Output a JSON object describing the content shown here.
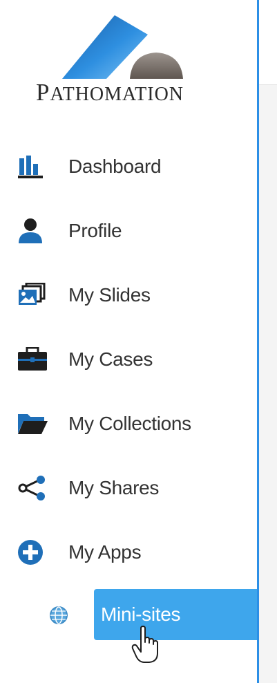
{
  "brand": {
    "logo_text_initial": "P",
    "logo_text_rest": "ATHOMATION"
  },
  "nav": {
    "items": [
      {
        "id": "dashboard",
        "label": "Dashboard",
        "icon": "bar-chart-icon"
      },
      {
        "id": "profile",
        "label": "Profile",
        "icon": "user-icon"
      },
      {
        "id": "slides",
        "label": "My Slides",
        "icon": "slides-icon"
      },
      {
        "id": "cases",
        "label": "My Cases",
        "icon": "briefcase-icon"
      },
      {
        "id": "collections",
        "label": "My Collections",
        "icon": "folder-open-icon"
      },
      {
        "id": "shares",
        "label": "My Shares",
        "icon": "share-icon"
      },
      {
        "id": "apps",
        "label": "My Apps",
        "icon": "plus-circle-icon"
      }
    ],
    "sub_item": {
      "label": "Mini-sites",
      "icon": "globe-icon",
      "active": true
    }
  },
  "colors": {
    "accent": "#2c8fe6",
    "active_bg": "#3ea6ec",
    "icon_blue": "#1f6fb8",
    "text": "#333333"
  }
}
